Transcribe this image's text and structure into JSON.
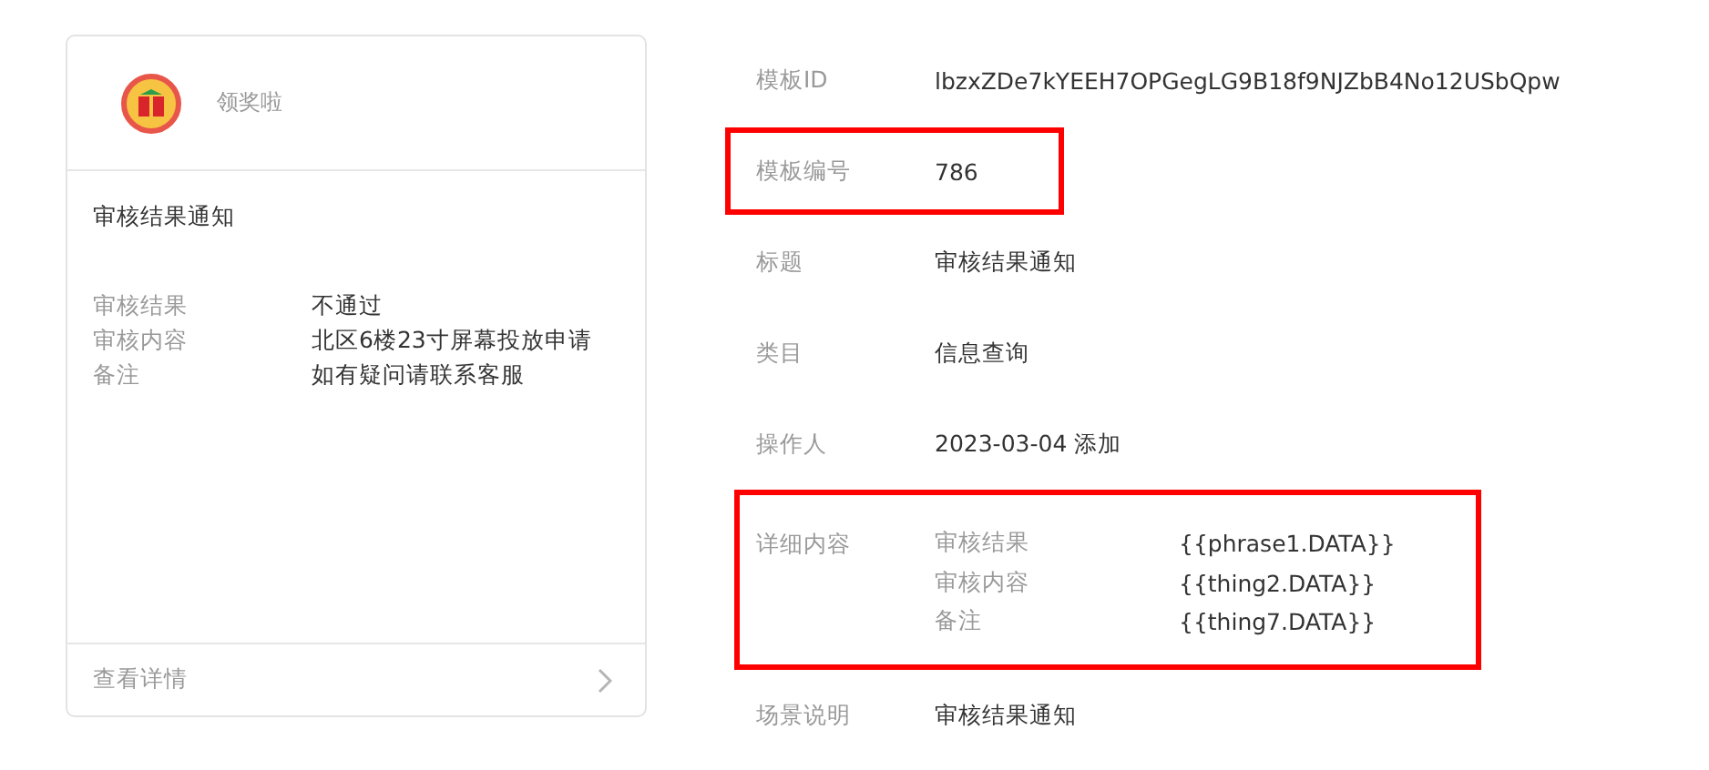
{
  "preview": {
    "account_name": "领奖啦",
    "title": "审核结果通知",
    "items": [
      {
        "label": "审核结果",
        "value": "不通过"
      },
      {
        "label": "审核内容",
        "value": "北区6楼23寸屏幕投放申请"
      },
      {
        "label": "备注",
        "value": "如有疑问请联系客服"
      }
    ],
    "footer_link": "查看详情"
  },
  "fields": [
    {
      "kind": "text",
      "label": "模板ID",
      "value": "lbzxZDe7kYEEH7OPGegLG9B18f9NJZbB4No12USbQpw",
      "highlighted": false
    },
    {
      "kind": "text",
      "label": "模板编号",
      "value": "786",
      "highlighted": true
    },
    {
      "kind": "text",
      "label": "标题",
      "value": "审核结果通知",
      "highlighted": false
    },
    {
      "kind": "text",
      "label": "类目",
      "value": "信息查询",
      "highlighted": false
    },
    {
      "kind": "text",
      "label": "操作人",
      "value": "2023-03-04 添加",
      "highlighted": false
    },
    {
      "kind": "detail",
      "label": "详细内容",
      "highlighted": true,
      "items": [
        {
          "label": "审核结果",
          "value": "{{phrase1.DATA}}"
        },
        {
          "label": "审核内容",
          "value": "{{thing2.DATA}}"
        },
        {
          "label": "备注",
          "value": "{{thing7.DATA}}"
        }
      ]
    },
    {
      "kind": "text",
      "label": "场景说明",
      "value": "审核结果通知",
      "highlighted": false
    }
  ]
}
